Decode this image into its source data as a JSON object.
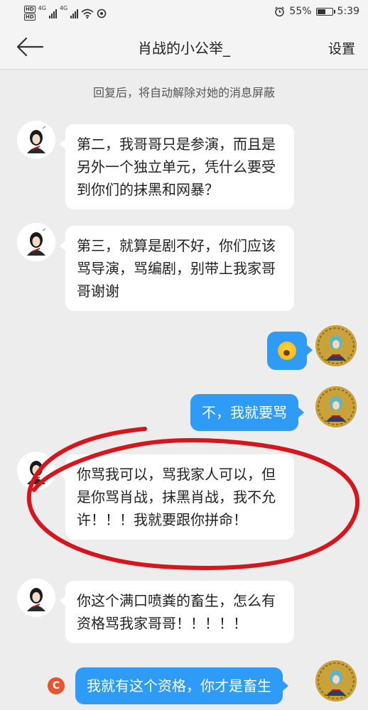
{
  "status_bar": {
    "hd1": "HD",
    "hd2": "HD",
    "net1": "4G",
    "net2": "4G",
    "battery_percent": "55%",
    "time": "5:39",
    "battery_level": 0.55,
    "icons": [
      "signal-icon",
      "wifi-icon",
      "data-saver-icon",
      "alarm-icon",
      "battery-icon"
    ]
  },
  "header": {
    "back_icon": "arrow-left-icon",
    "title": "肖战的小公举_",
    "action_label": "设置"
  },
  "notice": "回复后，将自动解除对她的消息屏蔽",
  "messages": [
    {
      "side": "left",
      "text": "第二，我哥哥只是参演，而且是另外一个独立单元，凭什么要受到你们的抹黑和网暴？"
    },
    {
      "side": "left",
      "text": "第三，就算是剧不好，你们应该骂导演，骂编剧，别带上我家哥哥谢谢"
    },
    {
      "side": "right",
      "emoji": "crying-face-emoji"
    },
    {
      "side": "right",
      "text": "不，我就要骂"
    },
    {
      "side": "left",
      "text": "你骂我可以，骂我家人可以，但是你骂肖战，抹黑肖战，我不允许！！！我就要跟你拼命！"
    },
    {
      "side": "left",
      "text": "你这个满口喷粪的畜生，怎么有资格骂我家哥哥！！！！！"
    },
    {
      "side": "right",
      "text": "我就有这个资格，你才是畜生",
      "status_icon": "failed-send-icon",
      "status_glyph": "C"
    }
  ],
  "colors": {
    "outgoing_bubble": "#2e9cf6",
    "incoming_bubble": "#ffffff",
    "background": "#ededed",
    "annotation": "#d6151d"
  }
}
